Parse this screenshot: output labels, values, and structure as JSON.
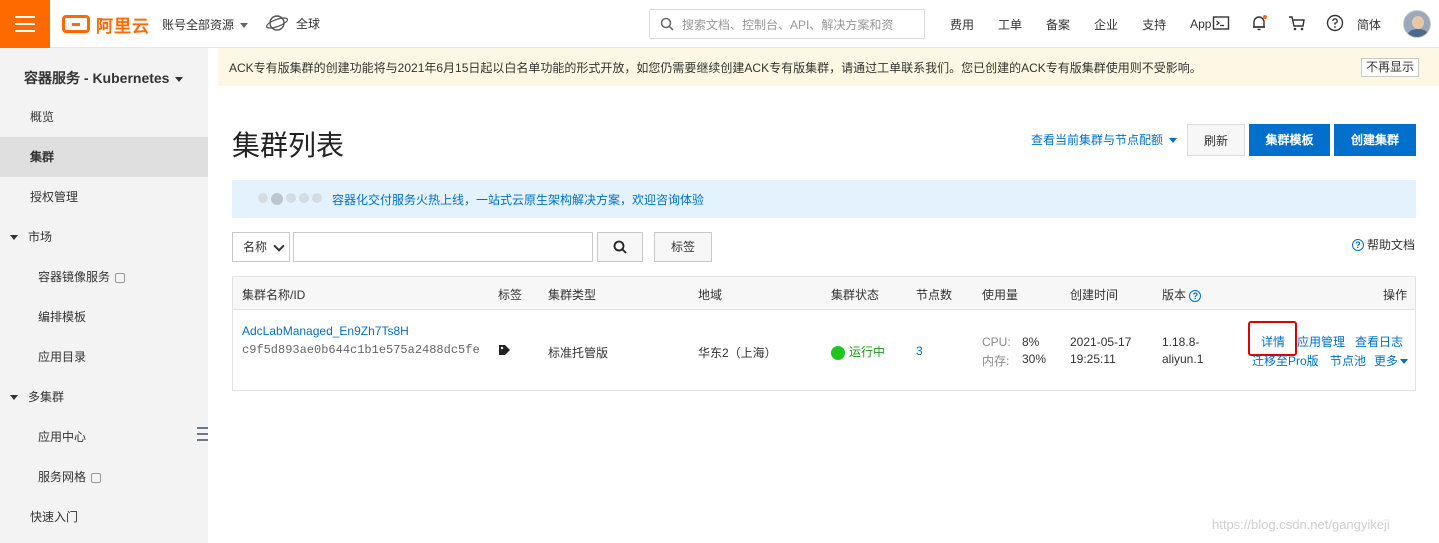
{
  "topbar": {
    "logo_text": "阿里云",
    "account": "账号全部资源",
    "region": "全球",
    "search_placeholder": "搜索文档、控制台、API、解决方案和资",
    "nav": [
      "费用",
      "工单",
      "备案",
      "企业",
      "支持",
      "App"
    ],
    "language": "简体",
    "accent_color": "#ff6a00"
  },
  "sidebar": {
    "title": "容器服务 - Kubernetes",
    "items": [
      {
        "label": "概览"
      },
      {
        "label": "集群"
      },
      {
        "label": "授权管理"
      },
      {
        "label": "市场"
      },
      {
        "label": "容器镜像服务"
      },
      {
        "label": "编排模板"
      },
      {
        "label": "应用目录"
      },
      {
        "label": "多集群"
      },
      {
        "label": "应用中心"
      },
      {
        "label": "服务网格"
      },
      {
        "label": "快速入门"
      }
    ]
  },
  "notice": {
    "text": "ACK专有版集群的创建功能将与2021年6月15日起以白名单功能的形式开放，如您仍需要继续创建ACK专有版集群，请通过工单联系我们。您已创建的ACK专有版集群使用则不受影响。",
    "dismiss": "不再显示"
  },
  "page": {
    "title": "集群列表",
    "quota_link": "查看当前集群与节点配额",
    "refresh": "刷新",
    "templates": "集群模板",
    "create": "创建集群"
  },
  "banner": {
    "text": "容器化交付服务火热上线，一站式云原生架构解决方案，欢迎咨询体验"
  },
  "filter": {
    "select_value": "名称",
    "tag_button": "标签",
    "help": "帮助文档"
  },
  "table": {
    "headers": {
      "name": "集群名称/ID",
      "tags": "标签",
      "type": "集群类型",
      "region": "地域",
      "status": "集群状态",
      "nodes": "节点数",
      "usage": "使用量",
      "created": "创建时间",
      "version": "版本",
      "actions": "操作"
    },
    "row": {
      "name": "AdcLabManaged_En9Zh7Ts8H",
      "id": "c9f5d893ae0b644c1b1e575a2488dc5fe",
      "type": "标准托管版",
      "region": "华东2（上海）",
      "status": "运行中",
      "nodes": "3",
      "cpu_label": "CPU:",
      "cpu_value": "8%",
      "mem_label": "内存:",
      "mem_value": "30%",
      "created_date": "2021-05-17",
      "created_time": "19:25:11",
      "version_line1": "1.18.8-",
      "version_line2": "aliyun.1",
      "actions": {
        "details": "详情",
        "app_mgmt": "应用管理",
        "logs": "查看日志",
        "migrate": "迁移至Pro版",
        "nodepool": "节点池",
        "more": "更多"
      }
    }
  },
  "watermark": "https://blog.csdn.net/gangyikeji"
}
